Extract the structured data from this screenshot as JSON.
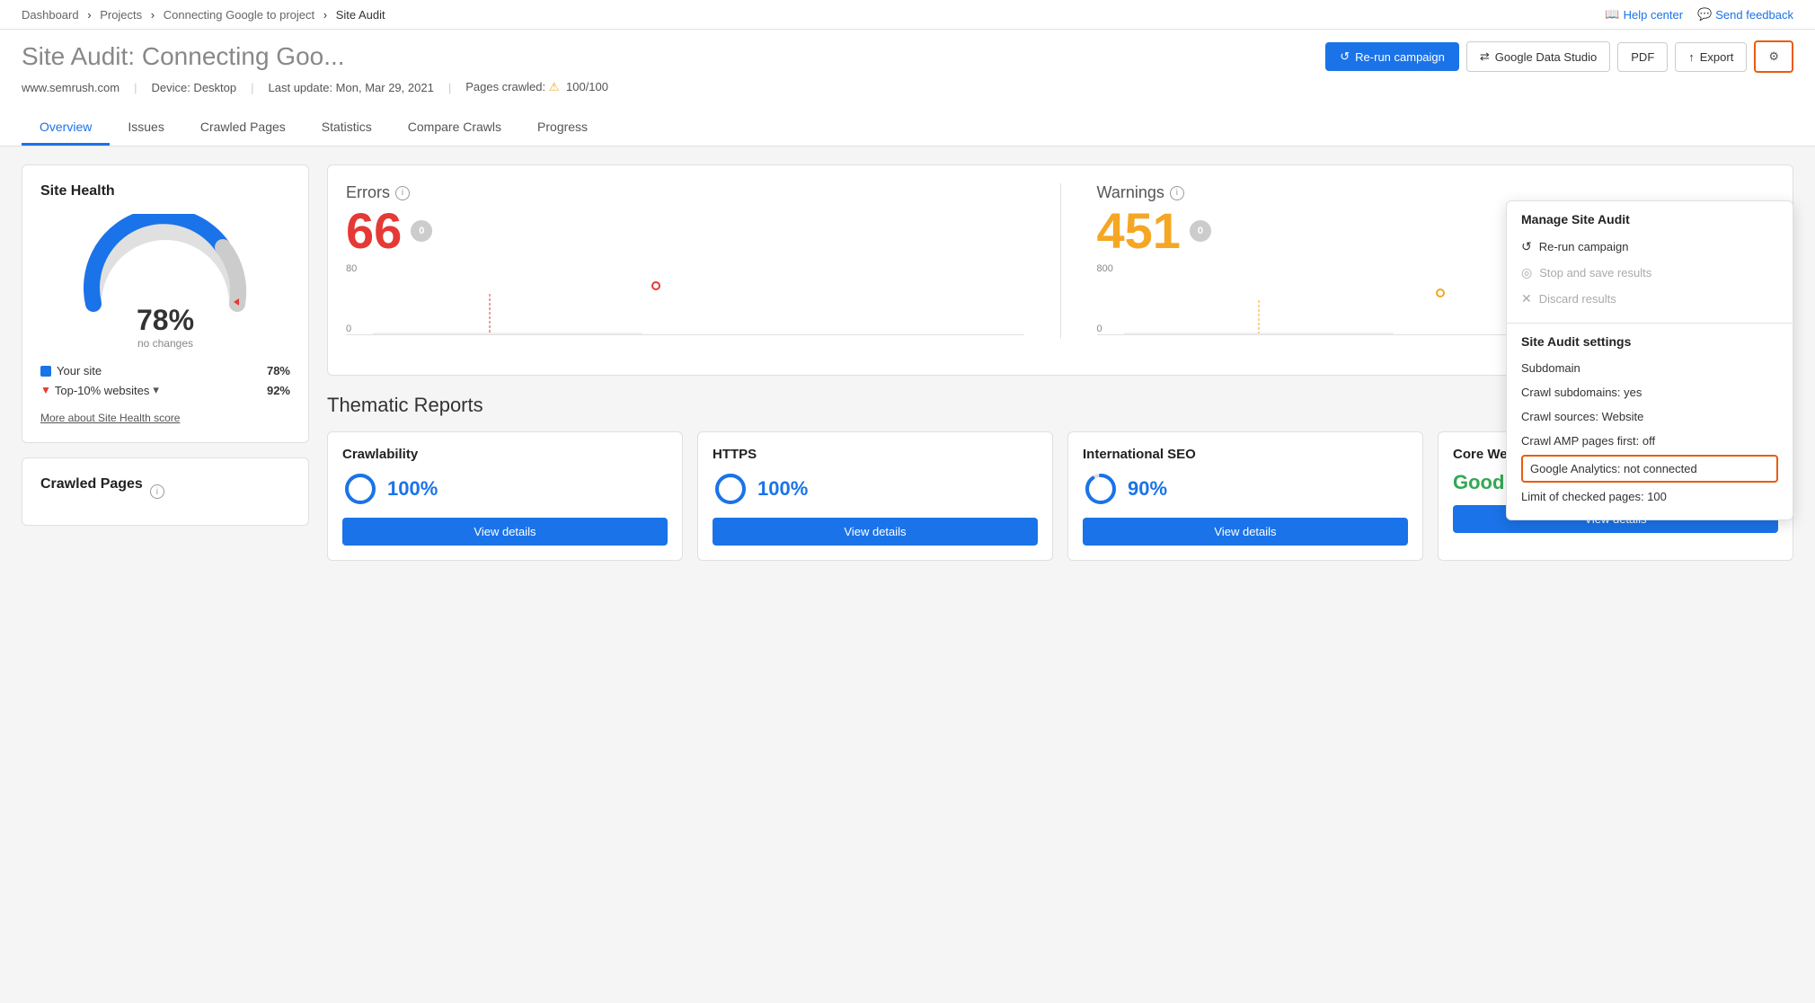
{
  "breadcrumb": {
    "items": [
      "Dashboard",
      "Projects",
      "Connecting Google to project",
      "Site Audit"
    ]
  },
  "top_actions": {
    "help_center": "Help center",
    "send_feedback": "Send feedback"
  },
  "header": {
    "title_bold": "Site Audit:",
    "title_light": "Connecting Goo...",
    "buttons": {
      "rerun": "Re-run campaign",
      "google_data_studio": "Google Data Studio",
      "pdf": "PDF",
      "export": "Export"
    }
  },
  "meta": {
    "domain": "www.semrush.com",
    "device": "Device: Desktop",
    "last_update": "Last update: Mon, Mar 29, 2021",
    "pages_crawled_label": "Pages crawled:",
    "pages_crawled_value": "100/100"
  },
  "nav_tabs": [
    "Overview",
    "Issues",
    "Crawled Pages",
    "Statistics",
    "Compare Crawls",
    "Progress"
  ],
  "active_tab": "Overview",
  "site_health": {
    "title": "Site Health",
    "percent": "78%",
    "label": "no changes",
    "legend": [
      {
        "key": "your_site",
        "label": "Your site",
        "value": "78%",
        "type": "blue"
      },
      {
        "key": "top10",
        "label": "Top-10% websites",
        "value": "92%",
        "type": "red-arrow"
      }
    ],
    "more_link": "More about Site Health score"
  },
  "errors": {
    "label": "Errors",
    "value": "66",
    "badge": "0",
    "chart_top": "80",
    "chart_bottom": "0"
  },
  "warnings": {
    "label": "Warnings",
    "value": "451",
    "badge": "0",
    "chart_top": "800",
    "chart_bottom": "0"
  },
  "thematic_reports": {
    "title": "Thematic Reports",
    "reports": [
      {
        "title": "Crawlability",
        "metric": "100%",
        "type": "percent",
        "beta": false
      },
      {
        "title": "HTTPS",
        "metric": "100%",
        "type": "percent",
        "beta": false
      },
      {
        "title": "International SEO",
        "metric": "90%",
        "type": "percent",
        "beta": false
      },
      {
        "title": "Core Web Vitals",
        "metric": "Good",
        "type": "text",
        "beta": true
      }
    ],
    "view_details_label": "View details"
  },
  "crawled_pages": {
    "title": "Crawled Pages"
  },
  "dropdown_menu": {
    "manage_title": "Manage Site Audit",
    "rerun_label": "Re-run campaign",
    "stop_label": "Stop and save results",
    "discard_label": "Discard results",
    "settings_title": "Site Audit settings",
    "settings_items": [
      {
        "key": "subdomain",
        "label": "Subdomain"
      },
      {
        "key": "crawl_subdomains",
        "label": "Crawl subdomains: yes"
      },
      {
        "key": "crawl_sources",
        "label": "Crawl sources: Website"
      },
      {
        "key": "crawl_amp",
        "label": "Crawl AMP pages first: off"
      },
      {
        "key": "google_analytics",
        "label": "Google Analytics: not connected",
        "highlighted": true
      },
      {
        "key": "limit",
        "label": "Limit of checked pages: 100"
      }
    ]
  }
}
